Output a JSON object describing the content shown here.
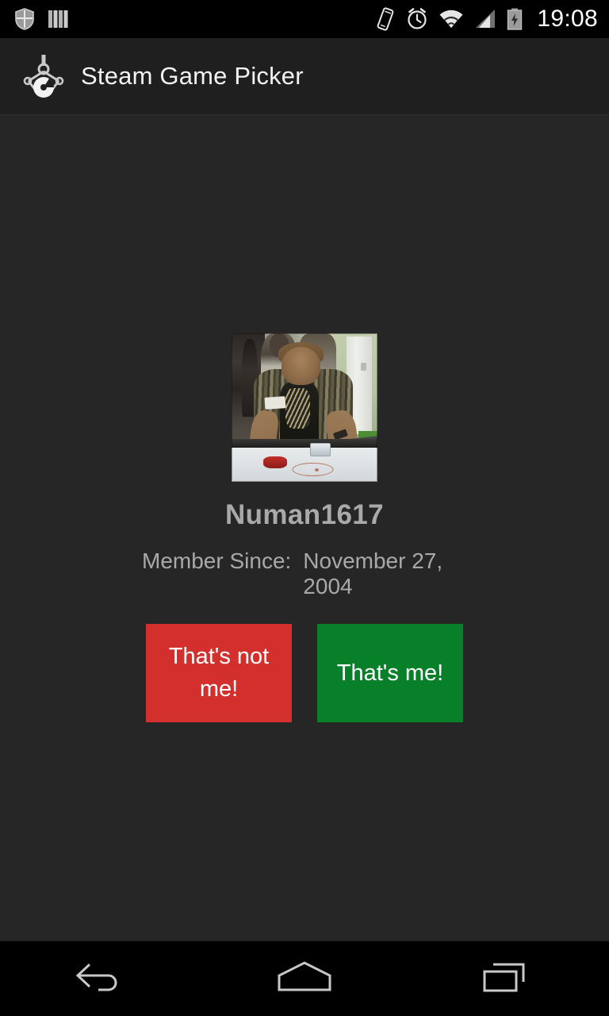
{
  "status_bar": {
    "background": "#000000",
    "left_icons": [
      {
        "name": "shield-icon",
        "label": "Security shield notification"
      },
      {
        "name": "columns-icon",
        "label": "Bookmarks / columns notification"
      }
    ],
    "right_icons": [
      {
        "name": "vibrate-icon",
        "label": "Vibrate mode"
      },
      {
        "name": "alarm-clock-icon",
        "label": "Alarm set"
      },
      {
        "name": "wifi-icon",
        "label": "Wi-Fi connected"
      },
      {
        "name": "cellular-signal-icon",
        "label": "Cellular signal"
      },
      {
        "name": "battery-charging-icon",
        "label": "Battery charging"
      }
    ],
    "clock": "19:08"
  },
  "action_bar": {
    "background": "#1f1f1f",
    "icon_name": "claw-crane-disc-icon",
    "title": "Steam Game Picker"
  },
  "main": {
    "background": "#262626",
    "avatar": {
      "name": "profile-avatar",
      "alt": "Person playing air hockey"
    },
    "username": "Numan1617",
    "member_since_label": "Member Since:",
    "member_since_value": "November 27, 2004",
    "buttons": [
      {
        "name": "thats-not-me-button",
        "label": "That's not me!",
        "color": "#d3302d"
      },
      {
        "name": "thats-me-button",
        "label": "That's me!",
        "color": "#08802a"
      }
    ]
  },
  "nav_bar": {
    "background": "#000000",
    "buttons": [
      {
        "name": "nav-back-button",
        "label": "Back"
      },
      {
        "name": "nav-home-button",
        "label": "Home"
      },
      {
        "name": "nav-recents-button",
        "label": "Recent apps"
      }
    ]
  }
}
